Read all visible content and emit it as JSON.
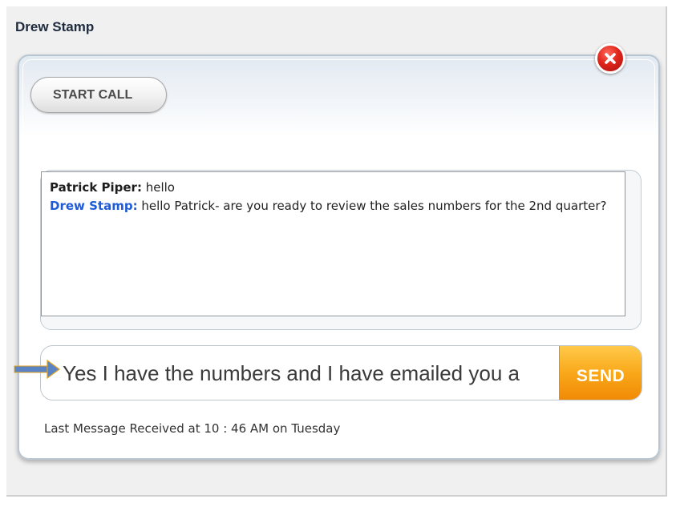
{
  "window": {
    "title": "Drew Stamp"
  },
  "toolbar": {
    "start_call_label": "START CALL",
    "close_icon": "close-icon",
    "close_label": "x"
  },
  "chat": {
    "messages": [
      {
        "sender": "Patrick Piper:",
        "text": " hello",
        "self": false
      },
      {
        "sender": "Drew Stamp:",
        "text": " hello Patrick- are you ready to review the sales numbers for the 2nd quarter?",
        "self": true
      }
    ]
  },
  "compose": {
    "value": "Yes I have the numbers and I have emailed you a",
    "placeholder": "",
    "send_label": "SEND",
    "arrow_icon": "arrow-right-icon"
  },
  "status": {
    "text": "Last Message Received at 10 : 46 AM on Tuesday"
  },
  "colors": {
    "self_sender": "#1f5bd6",
    "send_button": "#f9a81a",
    "close_button": "#e0261c",
    "arrow": "#5b84c4"
  }
}
